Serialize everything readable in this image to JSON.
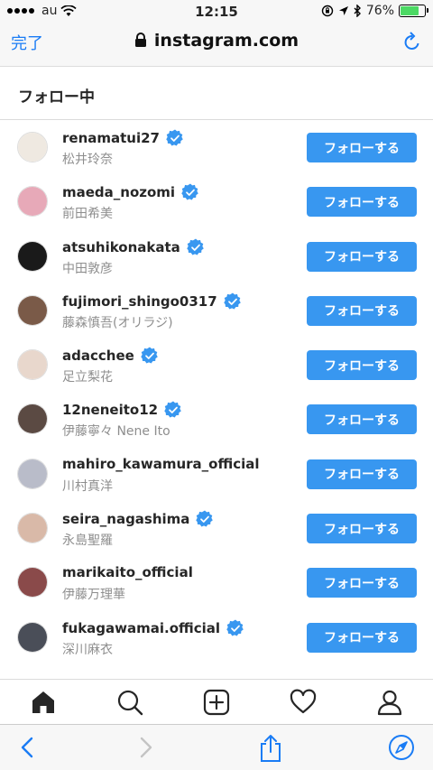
{
  "status_bar": {
    "carrier": "au",
    "time": "12:15",
    "battery": "76%",
    "battery_level": 0.76
  },
  "browser": {
    "done_label": "完了",
    "url": "instagram.com",
    "icons": [
      "lock-icon",
      "reload-icon"
    ]
  },
  "header": {
    "title": "フォロー中"
  },
  "follow_button_label": "フォローする",
  "accounts": [
    {
      "username": "renamatui27",
      "full_name": "松井玲奈",
      "verified": true,
      "avatar_color": "#efe9e1"
    },
    {
      "username": "maeda_nozomi",
      "full_name": "前田希美",
      "verified": true,
      "avatar_color": "#e7a9b8"
    },
    {
      "username": "atsuhikonakata",
      "full_name": "中田敦彦",
      "verified": true,
      "avatar_color": "#1a1a1a"
    },
    {
      "username": "fujimori_shingo0317",
      "full_name": "藤森慎吾(オリラジ)",
      "verified": true,
      "avatar_color": "#7a5a48"
    },
    {
      "username": "adacchee",
      "full_name": "足立梨花",
      "verified": true,
      "avatar_color": "#e8d7cc"
    },
    {
      "username": "12neneito12",
      "full_name": "伊藤寧々 Nene Ito",
      "verified": true,
      "avatar_color": "#5b4a43"
    },
    {
      "username": "mahiro_kawamura_official",
      "full_name": "川村真洋",
      "verified": false,
      "avatar_color": "#b9bcc9"
    },
    {
      "username": "seira_nagashima",
      "full_name": "永島聖羅",
      "verified": true,
      "avatar_color": "#d9b9a8"
    },
    {
      "username": "marikaito_official",
      "full_name": "伊藤万理華",
      "verified": false,
      "avatar_color": "#8a4a4a"
    },
    {
      "username": "fukagawamai.official",
      "full_name": "深川麻衣",
      "verified": true,
      "avatar_color": "#4a4e58"
    }
  ],
  "ig_nav": [
    "home-icon",
    "search-icon",
    "new-post-icon",
    "activity-heart-icon",
    "profile-icon"
  ],
  "safari_toolbar": [
    "back-icon",
    "forward-icon",
    "share-icon",
    "compass-icon"
  ],
  "colors": {
    "accent": "#3897f0",
    "ios_blue": "#1a7cf5",
    "verified": "#3897f0",
    "battery_green": "#4cd964"
  }
}
